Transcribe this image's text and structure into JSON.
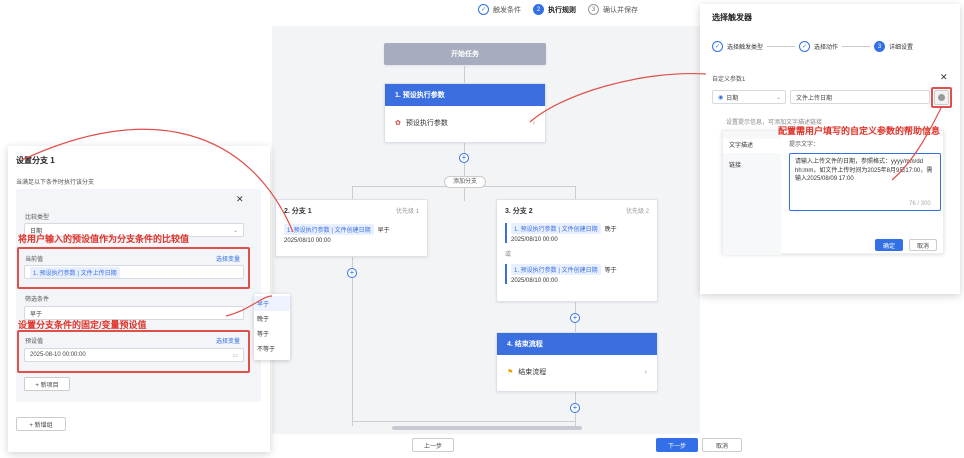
{
  "steps": [
    {
      "num": "✓",
      "label": "触发条件",
      "state": "done"
    },
    {
      "num": "2",
      "label": "执行规则",
      "state": "on"
    },
    {
      "num": "3",
      "label": "确认并保存",
      "state": ""
    }
  ],
  "flow": {
    "start": "开始任务",
    "node1_title": "1. 预设执行参数",
    "node1_item": "预设执行参数",
    "add_branch": "添加分支",
    "branch1_title": "2. 分支 1",
    "branch1_prio": "优先级 1",
    "branch1_cond_tag": "1. 预设执行参数 | 文件创建日期",
    "branch1_op": "早于",
    "branch1_date": "2025/08/10 00:00",
    "branch2_title": "3. 分支 2",
    "branch2_prio": "优先级 2",
    "branch2_cond1_tag": "1. 预设执行参数 | 文件创建日期",
    "branch2_cond1_op": "晚于",
    "branch2_cond1_date": "2025/08/10 00:00",
    "branch2_or": "或",
    "branch2_cond2_tag": "1. 预设执行参数 | 文件创建日期",
    "branch2_cond2_op": "等于",
    "branch2_cond2_date": "2025/08/10 00:00",
    "node4_title": "4. 结束流程",
    "node4_item": "结束流程"
  },
  "footer": {
    "prev": "上一步",
    "next": "下一步",
    "cancel": "取消"
  },
  "left_panel": {
    "title": "设置分支 1",
    "desc": "当满足以下条件时执行该分支",
    "compare_type_label": "比较类型",
    "compare_type_value": "日期",
    "current_label": "当前值",
    "current_link": "选择变量",
    "current_tag": "1. 预设执行参数 | 文件上传日期",
    "filter_label": "筛选条件",
    "filter_value": "早于",
    "preset_label": "预设值",
    "preset_link": "选择变量",
    "preset_value": "2025-08-10 00:00:00",
    "add_item": "+ 新项目",
    "add_cond": "+ 新增组",
    "options": [
      "早于",
      "晚于",
      "等于",
      "不等于"
    ]
  },
  "right_panel": {
    "title": "选择触发器",
    "steps": [
      {
        "label": "选择触发类型"
      },
      {
        "label": "选择动作"
      },
      {
        "num": "3",
        "label": "详细设置"
      }
    ],
    "param_title": "自定义参数1",
    "type_value": "日期",
    "name_value": "文件上传日期",
    "hint": "设置提示信息，可添加文字描述链接",
    "tab_text": "文字描述",
    "tab_link": "链接",
    "help_label": "提示文字：",
    "help_text": "请输入上传文件的日期，参照格式：yyyy/mm/dd hh:mm，如文件上传时间为2025年8月9日17:00，需输入2025/08/09 17:00",
    "count": "76 / 300",
    "ok": "确定",
    "cancel": "取消"
  },
  "annotations": {
    "a1": "将用户输入的预设值作为分支条件的比较值",
    "a2": "设置分支条件的固定/变量预设值",
    "a3": "配置需用户填写的自定义参数的帮助信息"
  }
}
